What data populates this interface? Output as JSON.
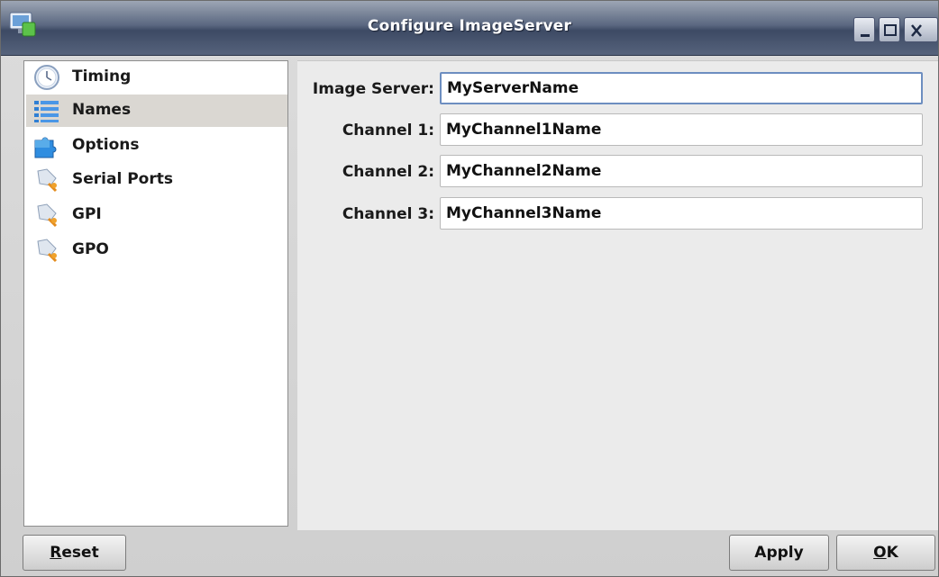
{
  "window": {
    "title": "Configure ImageServer",
    "title_icon": "app-monitor-icon"
  },
  "sidebar": {
    "items": [
      {
        "label": "Timing",
        "icon": "clock-icon",
        "selected": false
      },
      {
        "label": "Names",
        "icon": "list-icon",
        "selected": true
      },
      {
        "label": "Options",
        "icon": "puzzle-icon",
        "selected": false
      },
      {
        "label": "Serial Ports",
        "icon": "plug-icon",
        "selected": false
      },
      {
        "label": "GPI",
        "icon": "plug-icon",
        "selected": false
      },
      {
        "label": "GPO",
        "icon": "plug-icon",
        "selected": false
      }
    ]
  },
  "form": {
    "fields": [
      {
        "label": "Image Server:",
        "value": "MyServerName"
      },
      {
        "label": "Channel 1:",
        "value": "MyChannel1Name"
      },
      {
        "label": "Channel 2:",
        "value": "MyChannel2Name"
      },
      {
        "label": "Channel 3:",
        "value": "MyChannel3Name"
      }
    ]
  },
  "buttons": {
    "reset": {
      "mnemonic": "R",
      "rest": "eset"
    },
    "apply": {
      "mnemonic": "",
      "rest": "Apply"
    },
    "ok": {
      "mnemonic": "O",
      "rest": "K"
    }
  },
  "colors": {
    "titlebar": "#4a5770",
    "selected_row": "#dad7d2",
    "focus_border": "#6d8ec0"
  }
}
